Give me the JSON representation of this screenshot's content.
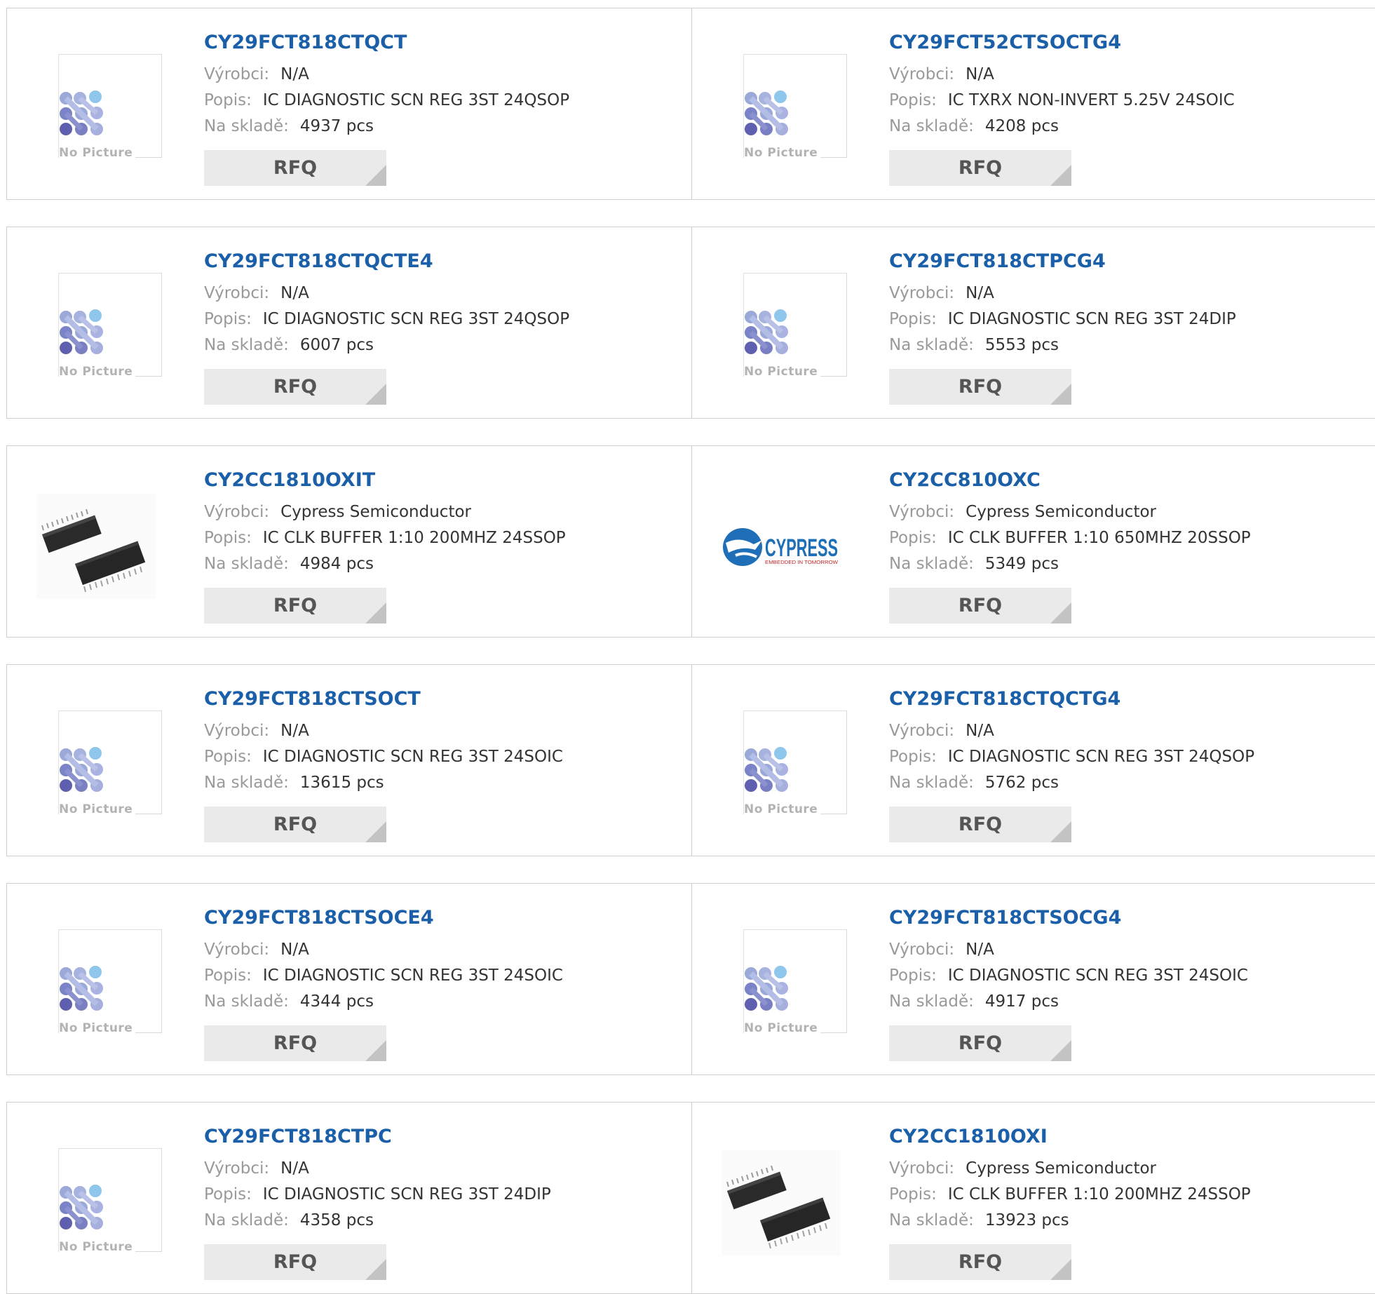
{
  "labels": {
    "manufacturer": "Výrobci:",
    "description": "Popis:",
    "stock": "Na skladě:",
    "rfq": "RFQ",
    "no_picture": "No Picture",
    "cypress_logo_text": "CYPRESS",
    "cypress_tagline": "EMBEDDED IN TOMORROW"
  },
  "colors": {
    "title": "#1a5fa8",
    "label": "#999999",
    "button_bg": "#eaeaea"
  },
  "products": [
    {
      "part": "CY29FCT818CTQCT",
      "manufacturer": "N/A",
      "description": "IC DIAGNOSTIC SCN REG 3ST 24QSOP",
      "stock": "4937 pcs",
      "image": "no-picture"
    },
    {
      "part": "CY29FCT52CTSOCTG4",
      "manufacturer": "N/A",
      "description": "IC TXRX NON-INVERT 5.25V 24SOIC",
      "stock": "4208 pcs",
      "image": "no-picture"
    },
    {
      "part": "CY29FCT818CTQCTE4",
      "manufacturer": "N/A",
      "description": "IC DIAGNOSTIC SCN REG 3ST 24QSOP",
      "stock": "6007 pcs",
      "image": "no-picture"
    },
    {
      "part": "CY29FCT818CTPCG4",
      "manufacturer": "N/A",
      "description": "IC DIAGNOSTIC SCN REG 3ST 24DIP",
      "stock": "5553 pcs",
      "image": "no-picture"
    },
    {
      "part": "CY2CC1810OXIT",
      "manufacturer": "Cypress Semiconductor",
      "description": "IC CLK BUFFER 1:10 200MHZ 24SSOP",
      "stock": "4984 pcs",
      "image": "ic-chip"
    },
    {
      "part": "CY2CC810OXC",
      "manufacturer": "Cypress Semiconductor",
      "description": "IC CLK BUFFER 1:10 650MHZ 20SSOP",
      "stock": "5349 pcs",
      "image": "cypress-logo"
    },
    {
      "part": "CY29FCT818CTSOCT",
      "manufacturer": "N/A",
      "description": "IC DIAGNOSTIC SCN REG 3ST 24SOIC",
      "stock": "13615 pcs",
      "image": "no-picture"
    },
    {
      "part": "CY29FCT818CTQCTG4",
      "manufacturer": "N/A",
      "description": "IC DIAGNOSTIC SCN REG 3ST 24QSOP",
      "stock": "5762 pcs",
      "image": "no-picture"
    },
    {
      "part": "CY29FCT818CTSOCE4",
      "manufacturer": "N/A",
      "description": "IC DIAGNOSTIC SCN REG 3ST 24SOIC",
      "stock": "4344 pcs",
      "image": "no-picture"
    },
    {
      "part": "CY29FCT818CTSOCG4",
      "manufacturer": "N/A",
      "description": "IC DIAGNOSTIC SCN REG 3ST 24SOIC",
      "stock": "4917 pcs",
      "image": "no-picture"
    },
    {
      "part": "CY29FCT818CTPC",
      "manufacturer": "N/A",
      "description": "IC DIAGNOSTIC SCN REG 3ST 24DIP",
      "stock": "4358 pcs",
      "image": "no-picture"
    },
    {
      "part": "CY2CC1810OXI",
      "manufacturer": "Cypress Semiconductor",
      "description": "IC CLK BUFFER 1:10 200MHZ 24SSOP",
      "stock": "13923 pcs",
      "image": "ic-chip"
    }
  ]
}
